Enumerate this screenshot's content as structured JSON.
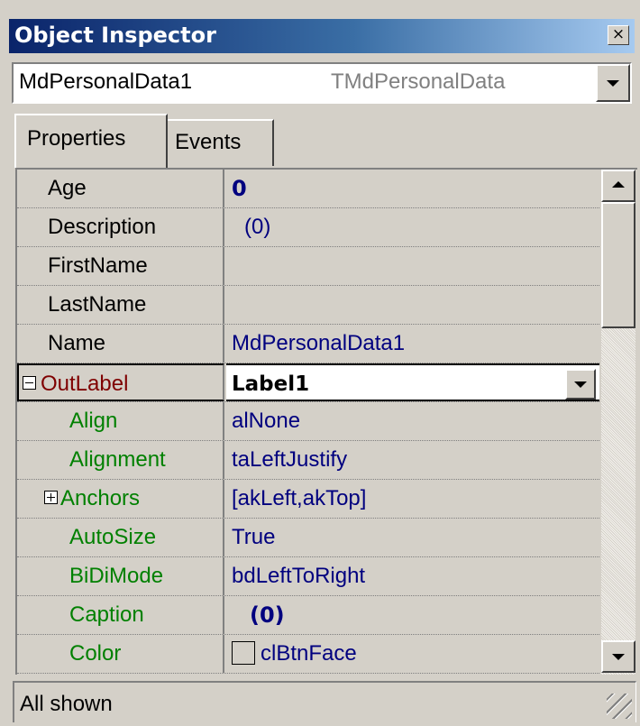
{
  "window": {
    "title": "Object Inspector",
    "close_glyph": "×"
  },
  "object_selector": {
    "name": "MdPersonalData1",
    "type": "TMdPersonalData"
  },
  "tabs": [
    {
      "label": "Properties",
      "active": true
    },
    {
      "label": "Events",
      "active": false
    }
  ],
  "properties": [
    {
      "name": "Age",
      "value": "0"
    },
    {
      "name": "Description",
      "value": "(0)"
    },
    {
      "name": "FirstName",
      "value": ""
    },
    {
      "name": "LastName",
      "value": ""
    },
    {
      "name": "Name",
      "value": "MdPersonalData1"
    },
    {
      "name": "OutLabel",
      "value": "Label1",
      "expanded": true
    },
    {
      "name": "Align",
      "value": "alNone"
    },
    {
      "name": "Alignment",
      "value": "taLeftJustify"
    },
    {
      "name": "Anchors",
      "value": "[akLeft,akTop]",
      "collapsed": true
    },
    {
      "name": "AutoSize",
      "value": "True"
    },
    {
      "name": "BiDiMode",
      "value": "bdLeftToRight"
    },
    {
      "name": "Caption",
      "value": "(0)"
    },
    {
      "name": "Color",
      "value": "clBtnFace"
    }
  ],
  "status": {
    "text": "All shown"
  },
  "colors": {
    "title_start": "#0a246a",
    "title_end": "#a6caf0",
    "value_text": "#00007f",
    "subproperty_text": "#008000",
    "object_reference_text": "#7f0000"
  }
}
